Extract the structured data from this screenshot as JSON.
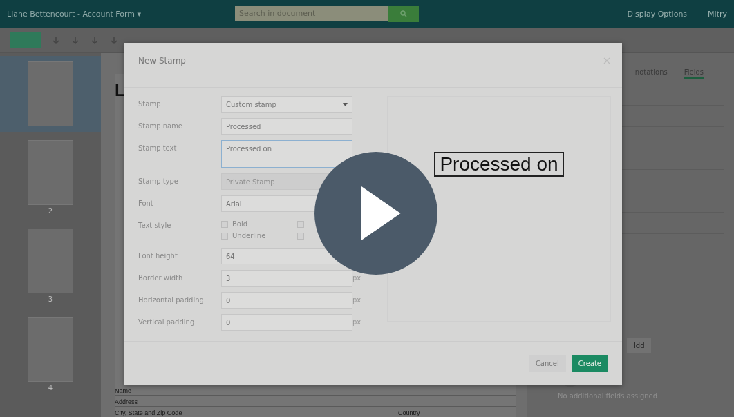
{
  "header": {
    "title": "Liane Bettencourt - Account Form",
    "title_caret": "▾",
    "search": {
      "placeholder": "Search in document"
    },
    "menu": [
      "Display Options",
      "Mitry"
    ]
  },
  "document": {
    "heading": "L",
    "rows": [
      {
        "label": "Name"
      },
      {
        "label": "Address"
      },
      {
        "label": "City, State and Zip Code",
        "extra": "Country"
      }
    ]
  },
  "thumbnails": [
    {
      "selected": true
    },
    {
      "selected": false,
      "page": "2"
    },
    {
      "selected": false,
      "page": "3"
    },
    {
      "selected": false,
      "page": "4"
    }
  ],
  "side_panel": {
    "tabs": [
      {
        "label": "notations",
        "selected": false
      },
      {
        "label": "Fields",
        "selected": true
      }
    ],
    "button": "ldd",
    "empty_text": "No additional fields assigned"
  },
  "dialog": {
    "title": "New Stamp",
    "fields": [
      {
        "kind": "select",
        "label": "Stamp",
        "value": "Custom stamp",
        "disabled": false
      },
      {
        "kind": "input",
        "label": "Stamp name",
        "value": "Processed"
      },
      {
        "kind": "textarea",
        "label": "Stamp text",
        "value": "Processed on",
        "focused": true
      },
      {
        "kind": "select",
        "label": "Stamp type",
        "value": "Private Stamp",
        "disabled": true
      },
      {
        "kind": "select",
        "label": "Font",
        "value": "Arial",
        "disabled": false
      },
      {
        "kind": "checks",
        "label": "Text style",
        "options": [
          {
            "label": "Bold",
            "checked": false
          },
          {
            "checked": false
          },
          {
            "label": "Underline",
            "checked": false
          },
          {
            "checked": false
          }
        ]
      },
      {
        "kind": "input",
        "label": "Font height",
        "value": "64"
      },
      {
        "kind": "input",
        "label": "Border width",
        "value": "3",
        "unit": "px"
      },
      {
        "kind": "input",
        "label": "Horizontal padding",
        "value": "0",
        "unit": "px"
      },
      {
        "kind": "input",
        "label": "Vertical padding",
        "value": "0",
        "unit": "px"
      }
    ],
    "preview": "Processed on",
    "buttons": [
      {
        "kind": "secondary",
        "label": "Cancel"
      },
      {
        "kind": "primary",
        "label": "Create"
      }
    ]
  }
}
